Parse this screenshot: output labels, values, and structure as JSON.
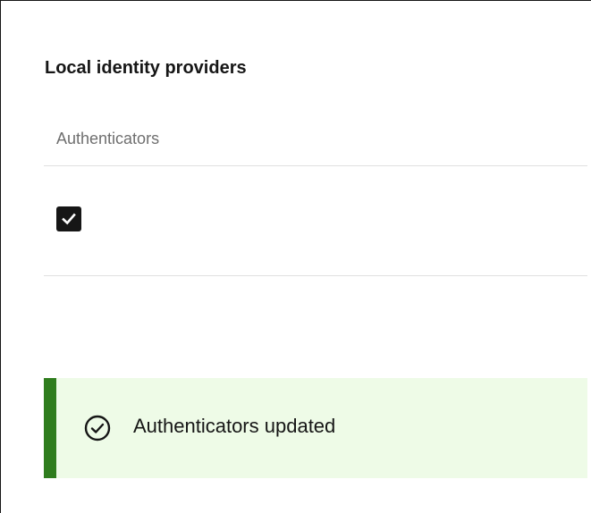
{
  "section": {
    "title": "Local identity providers"
  },
  "table": {
    "columns": [
      "Authenticators"
    ],
    "rows": [
      {
        "checked": true
      }
    ]
  },
  "notification": {
    "kind": "success",
    "message": "Authenticators updated",
    "icon": "checkmark-outline-icon",
    "accent_color": "#2f7d1e",
    "background_color": "#eefbe7"
  },
  "checkbox": {
    "fill_color": "#161616",
    "check_color": "#ffffff"
  }
}
